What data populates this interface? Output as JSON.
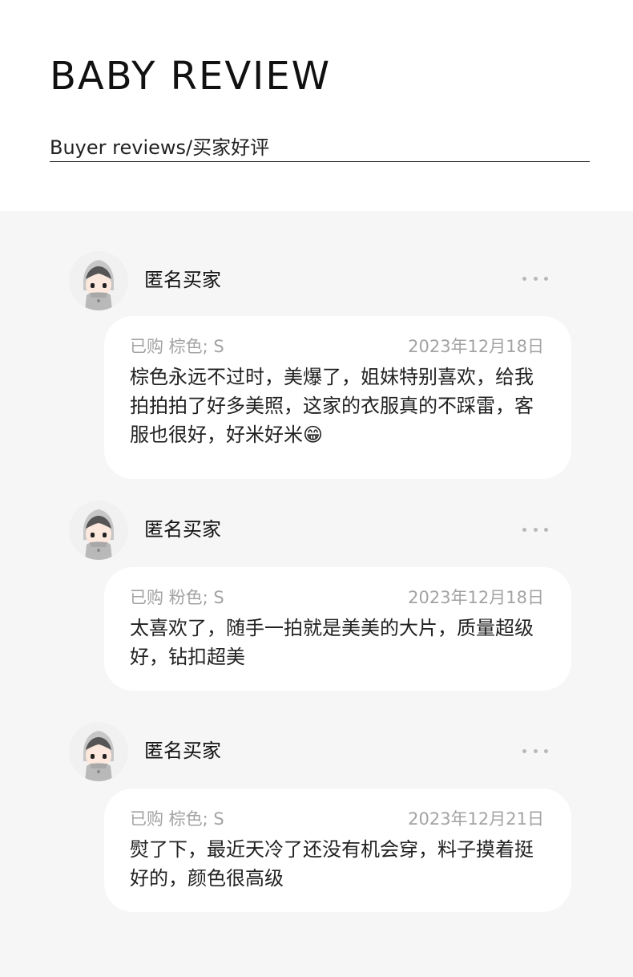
{
  "header": {
    "title": "BABY REVIEW",
    "subtitle": "Buyer reviews/买家好评"
  },
  "reviews": [
    {
      "username": "匿名买家",
      "meta": "已购 棕色; S",
      "date": "2023年12月18日",
      "text": "棕色永远不过时，美爆了，姐妹特别喜欢，给我拍拍拍了好多美照，这家的衣服真的不踩雷，客服也很好，好米好米😁",
      "avatar_icon": "anonymous-avatar-icon",
      "more_icon": "more-options-icon"
    },
    {
      "username": "匿名买家",
      "meta": "已购 粉色; S",
      "date": "2023年12月18日",
      "text": "太喜欢了，随手一拍就是美美的大片，质量超级好，钻扣超美",
      "avatar_icon": "anonymous-avatar-icon",
      "more_icon": "more-options-icon"
    },
    {
      "username": "匿名买家",
      "meta": "已购 棕色; S",
      "date": "2023年12月21日",
      "text": "熨了下，最近天冷了还没有机会穿，料子摸着挺好的，颜色很高级",
      "avatar_icon": "anonymous-avatar-icon",
      "more_icon": "more-options-icon"
    }
  ],
  "colors": {
    "background": "#f6f6f6",
    "card": "#ffffff",
    "muted_text": "#a3a3a3",
    "primary_text": "#222222"
  }
}
